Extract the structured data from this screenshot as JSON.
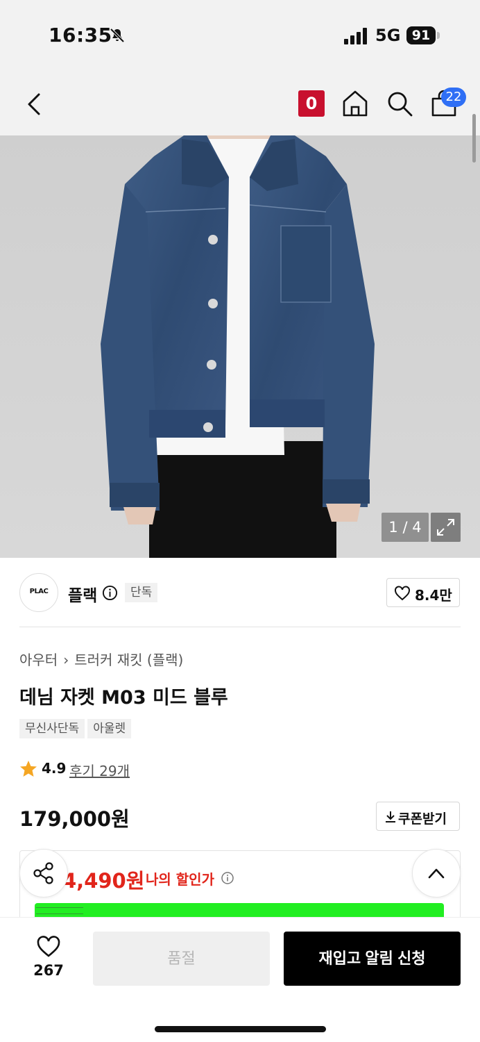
{
  "status_bar": {
    "time": "16:35",
    "network": "5G",
    "battery": "91"
  },
  "nav": {
    "o_badge": "0",
    "cart_count": "22"
  },
  "gallery": {
    "counter": "1 / 4"
  },
  "brand": {
    "logo_text": "PLAC",
    "name": "플랙",
    "tag": "단독",
    "likes": "8.4만"
  },
  "product": {
    "breadcrumb": [
      "아우터",
      "트러커 재킷 (플랙)"
    ],
    "title": "데님 자켓 M03 미드 블루",
    "tags": [
      "무신사단독",
      "아울렛"
    ],
    "rating": "4.9",
    "reviews": "후기 29개",
    "price": "179,000원",
    "coupon_label": "쿠폰받기",
    "discount_price": "4,490원",
    "discount_label": "나의 할인가"
  },
  "bottom": {
    "wish_count": "267",
    "soldout_label": "품절",
    "restock_label": "재입고 알림 신청"
  },
  "colors": {
    "accent_red": "#e1251b",
    "badge_blue": "#2f6ff5",
    "o_red": "#c8102e",
    "green_banner": "#22ee22"
  }
}
